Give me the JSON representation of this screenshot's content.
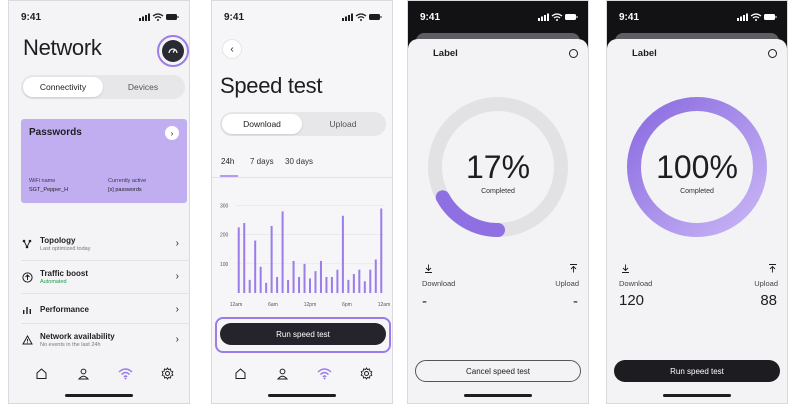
{
  "status_time": "9:41",
  "colors": {
    "accent": "#9b7ce8",
    "card": "#c1aef1",
    "dark_button": "#25232b",
    "green": "#1f9c4f",
    "ring_track": "#e2e2e5"
  },
  "network": {
    "title": "Network",
    "tabs": [
      "Connectivity",
      "Devices"
    ],
    "active_tab": "Connectivity",
    "card": {
      "title": "Passwords",
      "wifi_label": "WiFi name",
      "wifi_value": "SGT_Pepper_H",
      "active_label": "Currently active",
      "active_value": "[x] passwords"
    },
    "items": [
      {
        "title": "Topology",
        "subtitle": "Last optimized today",
        "icon": "topology-icon"
      },
      {
        "title": "Traffic boost",
        "subtitle": "Automated",
        "icon": "boost-icon"
      },
      {
        "title": "Performance",
        "subtitle": "",
        "icon": "bar-chart-icon"
      },
      {
        "title": "Network availability",
        "subtitle": "No events in the last 24h",
        "icon": "warning-icon"
      }
    ]
  },
  "speed": {
    "title": "Speed test",
    "tabs": [
      "Download",
      "Upload"
    ],
    "active_tab": "Download",
    "ranges": [
      "24h",
      "7 days",
      "30 days"
    ],
    "active_range": "24h",
    "run_label": "Run speed test"
  },
  "chart_data": {
    "type": "bar",
    "title": "",
    "xlabel": "",
    "ylabel": "",
    "yticks": [
      "300",
      "200",
      "100"
    ],
    "ylim": [
      0,
      350
    ],
    "xticks": [
      "12am",
      "6am",
      "12pm",
      "6pm",
      "12am"
    ],
    "values": [
      225,
      240,
      45,
      180,
      90,
      35,
      230,
      55,
      280,
      45,
      110,
      55,
      100,
      50,
      75,
      110,
      55,
      55,
      80,
      265,
      45,
      65,
      80,
      40,
      80,
      115,
      290
    ],
    "grid": true,
    "bar_color": "#9b7ce8"
  },
  "progress_a": {
    "label": "Label",
    "percent_text": "17%",
    "progress": 0.17,
    "completed": "Completed",
    "download_label": "Download",
    "upload_label": "Upload",
    "download_value": "-",
    "upload_value": "-",
    "button": "Cancel speed test"
  },
  "progress_b": {
    "label": "Label",
    "percent_text": "100%",
    "progress": 1.0,
    "completed": "Completed",
    "download_label": "Download",
    "upload_label": "Upload",
    "download_value": "120",
    "upload_value": "88",
    "button": "Run speed test"
  }
}
